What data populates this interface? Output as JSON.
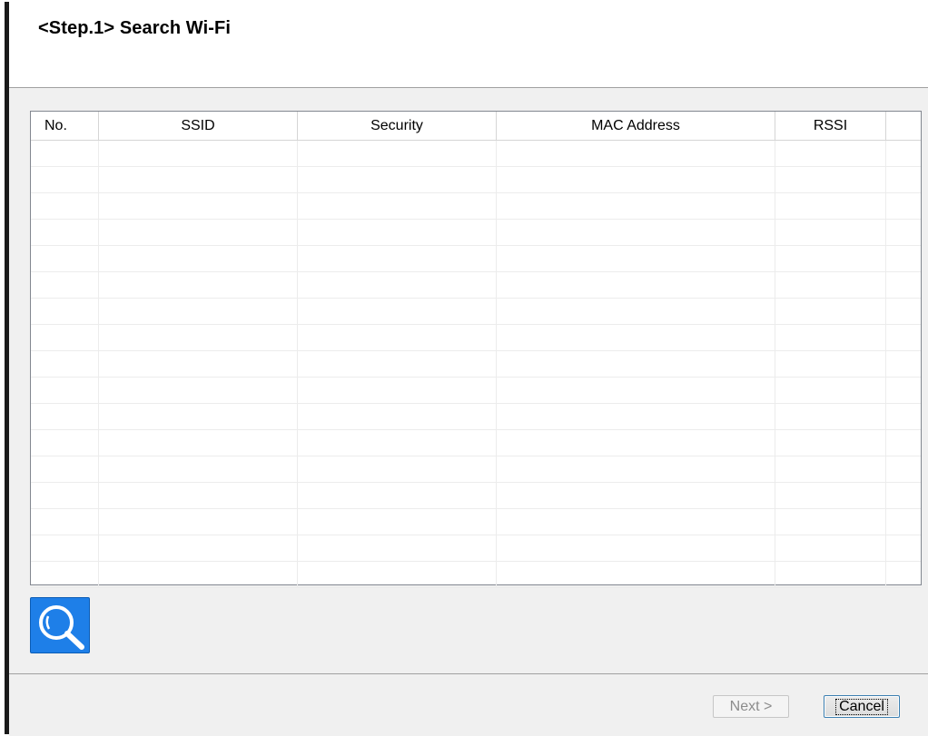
{
  "header": {
    "title": "<Step.1>  Search Wi-Fi"
  },
  "table": {
    "columns": [
      {
        "key": "no",
        "label": "No."
      },
      {
        "key": "ssid",
        "label": "SSID"
      },
      {
        "key": "security",
        "label": "Security"
      },
      {
        "key": "mac",
        "label": "MAC Address"
      },
      {
        "key": "rssi",
        "label": "RSSI"
      }
    ],
    "rows": []
  },
  "search_button": {
    "icon": "search-icon",
    "color": "#1e7fe8"
  },
  "footer": {
    "next_label": "Next >",
    "cancel_label": "Cancel"
  }
}
